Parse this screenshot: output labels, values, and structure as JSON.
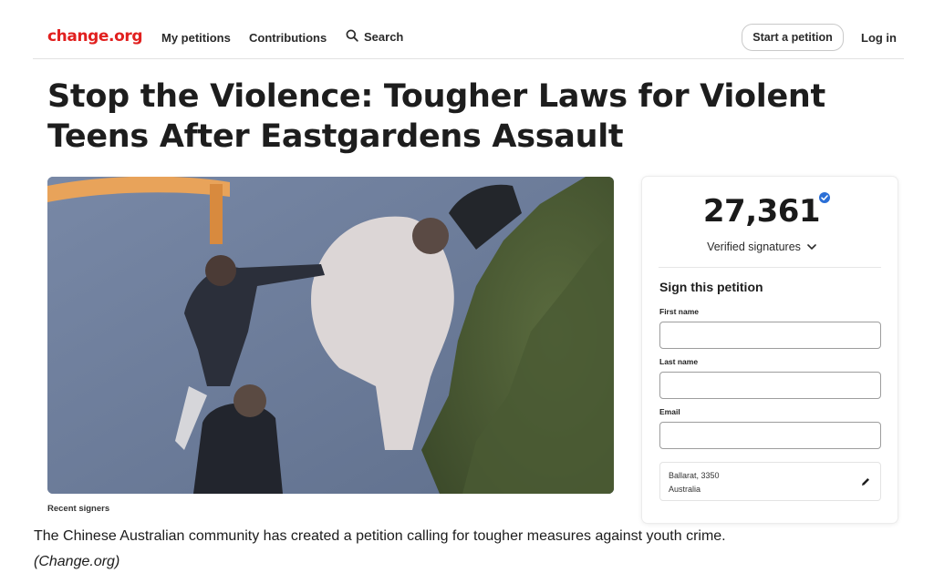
{
  "header": {
    "logo": "change.org",
    "nav": {
      "my_petitions": "My petitions",
      "contributions": "Contributions",
      "search": "Search"
    },
    "start_petition": "Start a petition",
    "login": "Log in"
  },
  "petition": {
    "title": "Stop the Violence: Tougher Laws for Violent Teens After Eastgardens Assault",
    "recent_signers_label": "Recent signers"
  },
  "sign_card": {
    "count": "27,361",
    "verified_label": "Verified signatures",
    "sign_title": "Sign this petition",
    "first_name_label": "First name",
    "first_name_value": "",
    "last_name_label": "Last name",
    "last_name_value": "",
    "email_label": "Email",
    "email_value": "",
    "location_line1": "Ballarat, 3350",
    "location_line2": "Australia"
  },
  "caption": {
    "text": "The Chinese Australian community has created a petition calling for tougher measures against youth crime.",
    "credit": "(Change.org)"
  },
  "colors": {
    "brand": "#e1201f",
    "verified_badge": "#2b6fd6"
  },
  "icons": [
    "search-icon",
    "verified-badge-icon",
    "chevron-down-icon",
    "pencil-icon"
  ]
}
